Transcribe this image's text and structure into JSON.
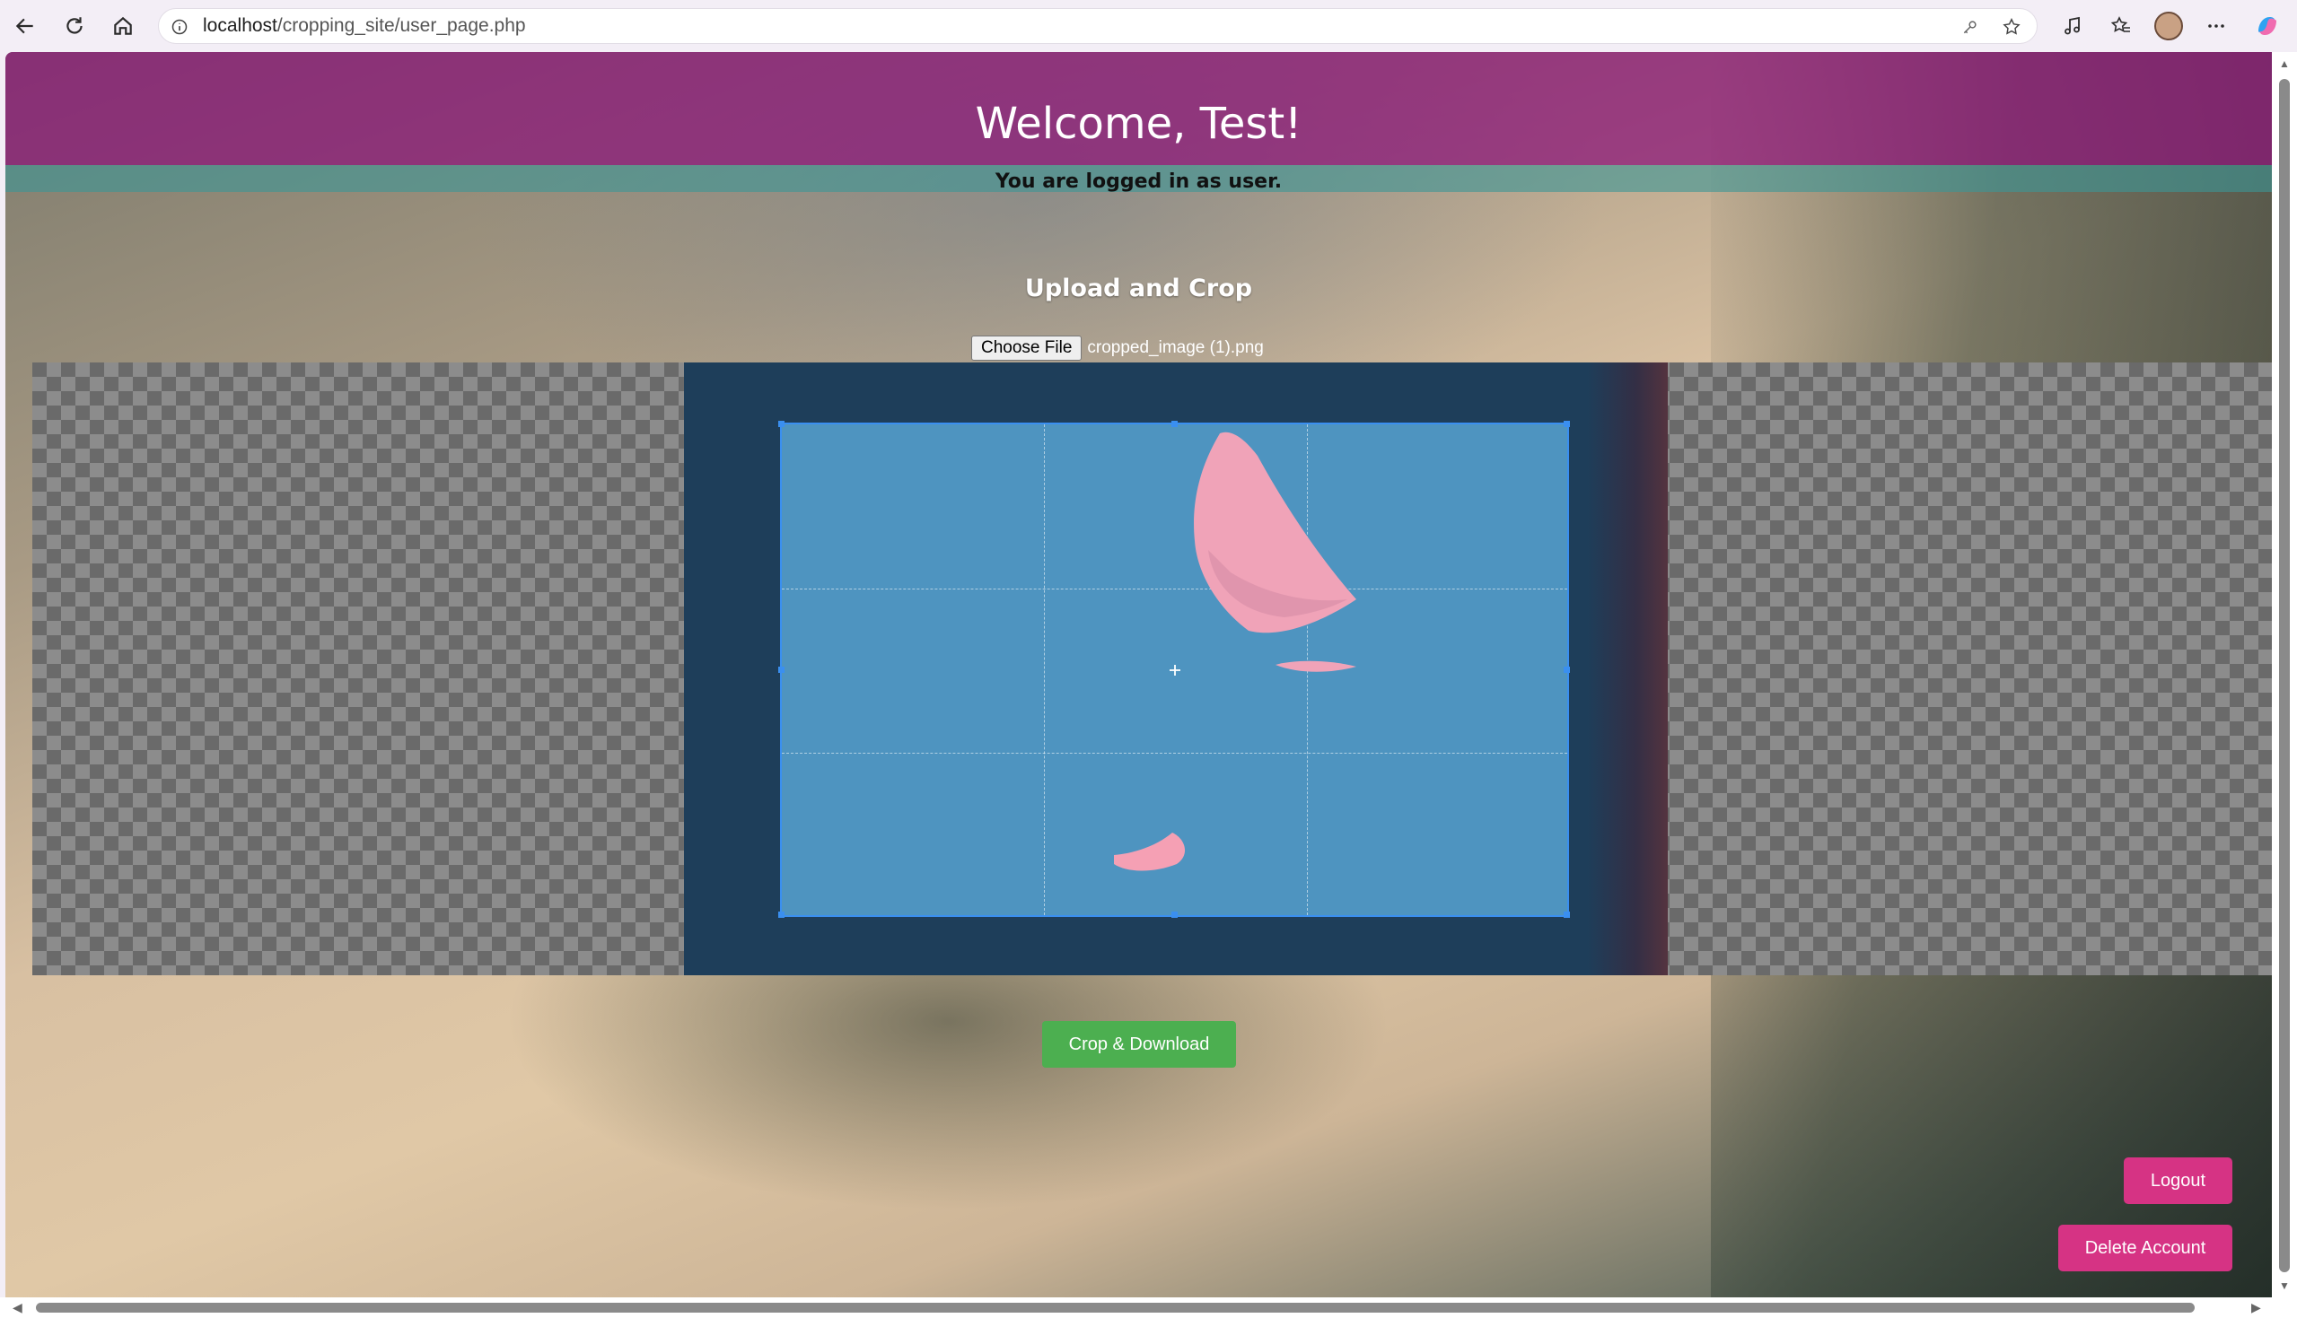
{
  "browser": {
    "url_host": "localhost",
    "url_path": "/cropping_site/user_page.php"
  },
  "header": {
    "welcome": "Welcome, Test!",
    "logged_in": "You are logged in as user."
  },
  "upload": {
    "title": "Upload and Crop",
    "choose_file_label": "Choose File",
    "file_name": "cropped_image (1).png"
  },
  "actions": {
    "crop_download": "Crop & Download",
    "logout": "Logout",
    "delete_account": "Delete Account"
  },
  "colors": {
    "header_band": "#8c1478",
    "crop_button": "#4caf50",
    "account_buttons": "#d63384",
    "crop_box": "#4e94c0",
    "crop_border": "#3a8ff0"
  },
  "icons": [
    "back-icon",
    "refresh-icon",
    "home-icon",
    "info-icon",
    "key-icon",
    "star-icon",
    "music-icon",
    "favorites-icon",
    "more-icon",
    "copilot-icon"
  ]
}
